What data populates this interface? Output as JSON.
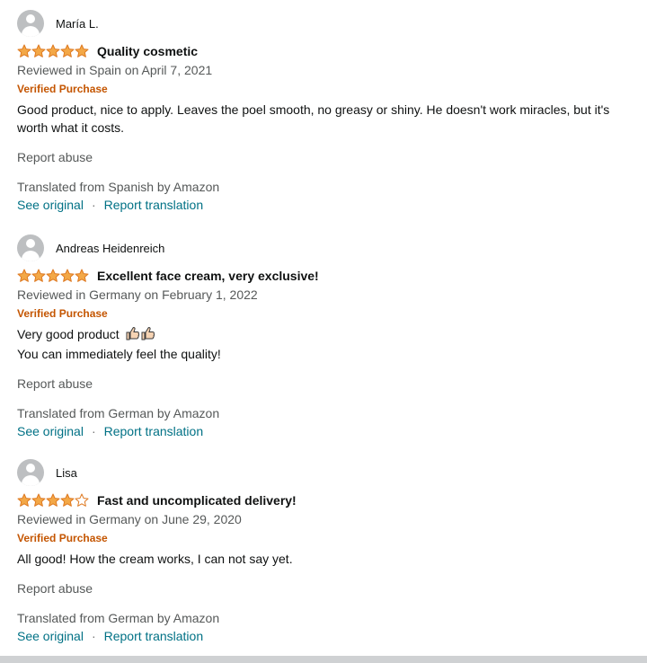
{
  "colors": {
    "star": "#f3a847",
    "star_stroke": "#de7921",
    "link": "#007185",
    "verified": "#c45500",
    "muted": "#565959"
  },
  "icons": {
    "avatar": "default-profile-avatar",
    "star": "star-icon",
    "thumb": "thumbs-up-emoji"
  },
  "reviews": [
    {
      "reviewer": "María L.",
      "rating": 5,
      "title": "Quality cosmetic",
      "date": "Reviewed in Spain on April 7, 2021",
      "verified": "Verified Purchase",
      "body_lines": [
        "Good product, nice to apply. Leaves the poel smooth, no greasy or shiny. He doesn't work miracles, but it's",
        "worth what it costs."
      ],
      "report": "Report abuse",
      "translated": "Translated from Spanish by Amazon",
      "see_original": "See original",
      "report_translation": "Report translation"
    },
    {
      "reviewer": "Andreas Heidenreich",
      "rating": 5,
      "title": "Excellent face cream, very exclusive!",
      "date": "Reviewed in Germany on February 1, 2022",
      "verified": "Verified Purchase",
      "body_lines": [
        "Very good product",
        "You can immediately feel the quality!"
      ],
      "report": "Report abuse",
      "translated": "Translated from German by Amazon",
      "see_original": "See original",
      "report_translation": "Report translation"
    },
    {
      "reviewer": "Lisa",
      "rating": 4,
      "title": "Fast and uncomplicated delivery!",
      "date": "Reviewed in Germany on June 29, 2020",
      "verified": "Verified Purchase",
      "body_lines": [
        "All good! How the cream works, I can not say yet."
      ],
      "report": "Report abuse",
      "translated": "Translated from German by Amazon",
      "see_original": "See original",
      "report_translation": "Report translation"
    }
  ],
  "separator": "·"
}
